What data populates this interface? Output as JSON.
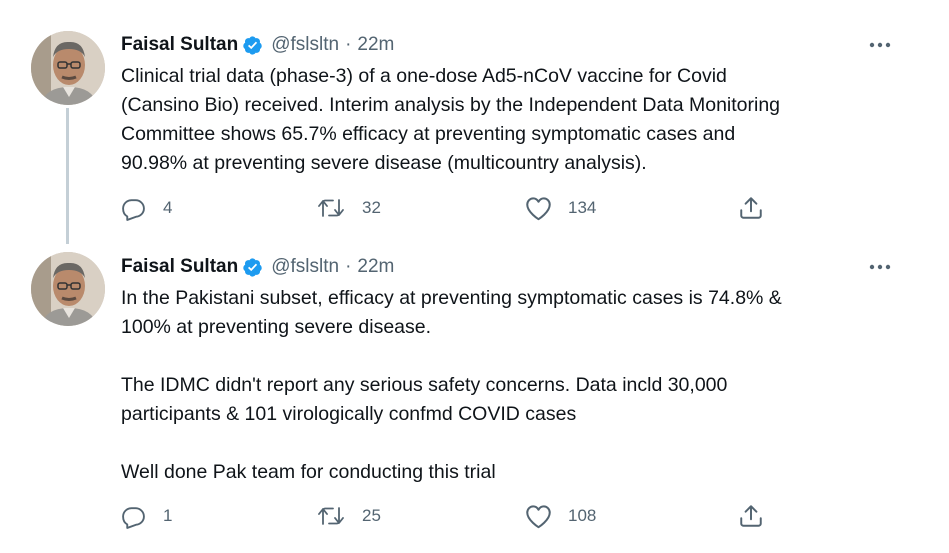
{
  "tweets": [
    {
      "author_name": "Faisal Sultan",
      "handle": "@fslsltn",
      "separator": "·",
      "time": "22m",
      "text": "Clinical trial data (phase-3) of a one-dose Ad5-nCoV vaccine for Covid\n(Cansino Bio) received. Interim analysis by the Independent Data Monitoring\nCommittee shows 65.7% efficacy at preventing symptomatic cases and\n90.98% at preventing severe disease (multicountry analysis).",
      "replies": "4",
      "retweets": "32",
      "likes": "134"
    },
    {
      "author_name": "Faisal Sultan",
      "handle": "@fslsltn",
      "separator": "·",
      "time": "22m",
      "text": "In the Pakistani subset, efficacy at preventing symptomatic cases is 74.8% &\n100% at preventing severe disease.\n\nThe IDMC didn't report any serious safety concerns. Data incld 30,000\nparticipants & 101 virologically confmd COVID cases\n\nWell done Pak team for conducting this trial",
      "replies": "1",
      "retweets": "25",
      "likes": "108"
    }
  ],
  "colors": {
    "text_primary": "#0f1419",
    "text_secondary": "#536471",
    "verified_blue": "#1d9bf0",
    "thread_line": "#c4cfd6"
  },
  "icons": [
    "verified-badge-icon",
    "more-icon",
    "reply-icon",
    "retweet-icon",
    "like-icon",
    "share-icon"
  ]
}
